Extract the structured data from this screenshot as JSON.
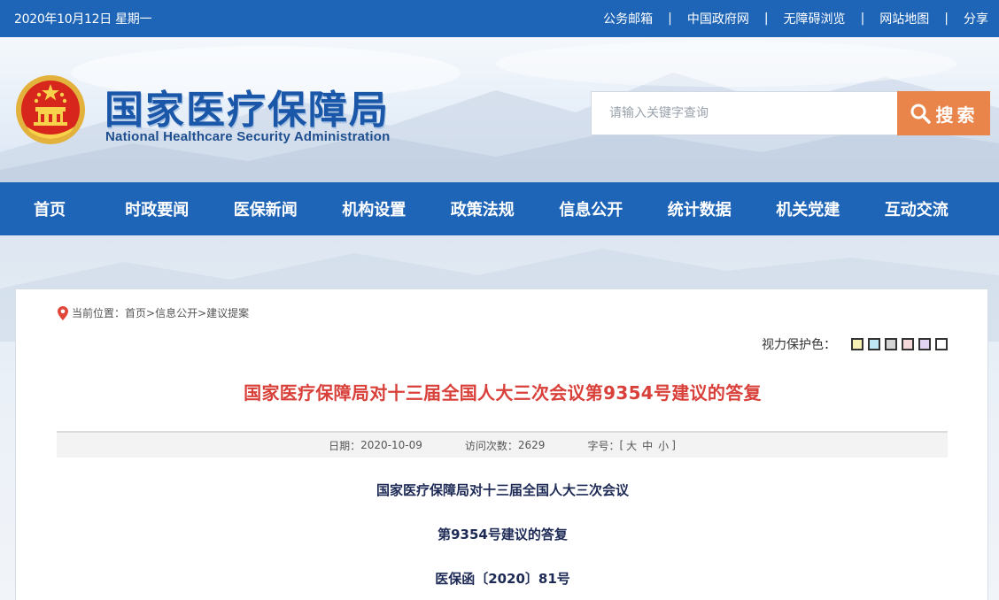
{
  "topbar": {
    "date": "2020年10月12日 星期一",
    "links": [
      "公务邮箱",
      "中国政府网",
      "无障碍浏览",
      "网站地图",
      "分享"
    ],
    "separator": "|"
  },
  "header": {
    "brand_cn": "国家医疗保障局",
    "brand_en": "National Healthcare Security Administration",
    "search_placeholder": "请输入关键字查询",
    "search_button": "搜索"
  },
  "nav": [
    "首页",
    "时政要闻",
    "医保新闻",
    "机构设置",
    "政策法规",
    "信息公开",
    "统计数据",
    "机关党建",
    "互动交流"
  ],
  "breadcrumb": {
    "prefix": "当前位置：",
    "items": [
      "首页",
      "信息公开",
      "建议提案"
    ],
    "sep": ">"
  },
  "eye_care": {
    "label": "视力保护色：",
    "swatches": [
      "#f7f1b4",
      "#bfe6f3",
      "#d4d4d4",
      "#f5d9da",
      "#e2d2f3",
      "#ffffff"
    ]
  },
  "article": {
    "title": "国家医疗保障局对十三届全国人大三次会议第9354号建议的答复",
    "date_label": "日期：",
    "date": "2020-10-09",
    "visits_label": "访问次数：",
    "visits": "2629",
    "font_label": "字号：",
    "font_open": "[",
    "font_sizes": [
      "大",
      "中",
      "小"
    ],
    "font_close": "]",
    "lines": [
      "国家医疗保障局对十三届全国人大三次会议",
      "第9354号建议的答复",
      "医保函〔2020〕81号"
    ]
  },
  "colors": {
    "primary": "#1f65b7",
    "search_btn": "#e9844a",
    "title_red": "#d9403a"
  }
}
